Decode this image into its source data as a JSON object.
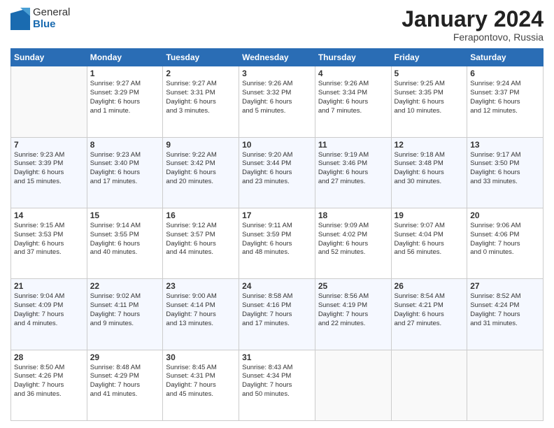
{
  "logo": {
    "general": "General",
    "blue": "Blue"
  },
  "title": "January 2024",
  "location": "Ferapontovo, Russia",
  "days_header": [
    "Sunday",
    "Monday",
    "Tuesday",
    "Wednesday",
    "Thursday",
    "Friday",
    "Saturday"
  ],
  "weeks": [
    [
      {
        "num": "",
        "detail": ""
      },
      {
        "num": "1",
        "detail": "Sunrise: 9:27 AM\nSunset: 3:29 PM\nDaylight: 6 hours\nand 1 minute."
      },
      {
        "num": "2",
        "detail": "Sunrise: 9:27 AM\nSunset: 3:31 PM\nDaylight: 6 hours\nand 3 minutes."
      },
      {
        "num": "3",
        "detail": "Sunrise: 9:26 AM\nSunset: 3:32 PM\nDaylight: 6 hours\nand 5 minutes."
      },
      {
        "num": "4",
        "detail": "Sunrise: 9:26 AM\nSunset: 3:34 PM\nDaylight: 6 hours\nand 7 minutes."
      },
      {
        "num": "5",
        "detail": "Sunrise: 9:25 AM\nSunset: 3:35 PM\nDaylight: 6 hours\nand 10 minutes."
      },
      {
        "num": "6",
        "detail": "Sunrise: 9:24 AM\nSunset: 3:37 PM\nDaylight: 6 hours\nand 12 minutes."
      }
    ],
    [
      {
        "num": "7",
        "detail": "Sunrise: 9:23 AM\nSunset: 3:39 PM\nDaylight: 6 hours\nand 15 minutes."
      },
      {
        "num": "8",
        "detail": "Sunrise: 9:23 AM\nSunset: 3:40 PM\nDaylight: 6 hours\nand 17 minutes."
      },
      {
        "num": "9",
        "detail": "Sunrise: 9:22 AM\nSunset: 3:42 PM\nDaylight: 6 hours\nand 20 minutes."
      },
      {
        "num": "10",
        "detail": "Sunrise: 9:20 AM\nSunset: 3:44 PM\nDaylight: 6 hours\nand 23 minutes."
      },
      {
        "num": "11",
        "detail": "Sunrise: 9:19 AM\nSunset: 3:46 PM\nDaylight: 6 hours\nand 27 minutes."
      },
      {
        "num": "12",
        "detail": "Sunrise: 9:18 AM\nSunset: 3:48 PM\nDaylight: 6 hours\nand 30 minutes."
      },
      {
        "num": "13",
        "detail": "Sunrise: 9:17 AM\nSunset: 3:50 PM\nDaylight: 6 hours\nand 33 minutes."
      }
    ],
    [
      {
        "num": "14",
        "detail": "Sunrise: 9:15 AM\nSunset: 3:53 PM\nDaylight: 6 hours\nand 37 minutes."
      },
      {
        "num": "15",
        "detail": "Sunrise: 9:14 AM\nSunset: 3:55 PM\nDaylight: 6 hours\nand 40 minutes."
      },
      {
        "num": "16",
        "detail": "Sunrise: 9:12 AM\nSunset: 3:57 PM\nDaylight: 6 hours\nand 44 minutes."
      },
      {
        "num": "17",
        "detail": "Sunrise: 9:11 AM\nSunset: 3:59 PM\nDaylight: 6 hours\nand 48 minutes."
      },
      {
        "num": "18",
        "detail": "Sunrise: 9:09 AM\nSunset: 4:02 PM\nDaylight: 6 hours\nand 52 minutes."
      },
      {
        "num": "19",
        "detail": "Sunrise: 9:07 AM\nSunset: 4:04 PM\nDaylight: 6 hours\nand 56 minutes."
      },
      {
        "num": "20",
        "detail": "Sunrise: 9:06 AM\nSunset: 4:06 PM\nDaylight: 7 hours\nand 0 minutes."
      }
    ],
    [
      {
        "num": "21",
        "detail": "Sunrise: 9:04 AM\nSunset: 4:09 PM\nDaylight: 7 hours\nand 4 minutes."
      },
      {
        "num": "22",
        "detail": "Sunrise: 9:02 AM\nSunset: 4:11 PM\nDaylight: 7 hours\nand 9 minutes."
      },
      {
        "num": "23",
        "detail": "Sunrise: 9:00 AM\nSunset: 4:14 PM\nDaylight: 7 hours\nand 13 minutes."
      },
      {
        "num": "24",
        "detail": "Sunrise: 8:58 AM\nSunset: 4:16 PM\nDaylight: 7 hours\nand 17 minutes."
      },
      {
        "num": "25",
        "detail": "Sunrise: 8:56 AM\nSunset: 4:19 PM\nDaylight: 7 hours\nand 22 minutes."
      },
      {
        "num": "26",
        "detail": "Sunrise: 8:54 AM\nSunset: 4:21 PM\nDaylight: 6 hours\nand 27 minutes."
      },
      {
        "num": "27",
        "detail": "Sunrise: 8:52 AM\nSunset: 4:24 PM\nDaylight: 7 hours\nand 31 minutes."
      }
    ],
    [
      {
        "num": "28",
        "detail": "Sunrise: 8:50 AM\nSunset: 4:26 PM\nDaylight: 7 hours\nand 36 minutes."
      },
      {
        "num": "29",
        "detail": "Sunrise: 8:48 AM\nSunset: 4:29 PM\nDaylight: 7 hours\nand 41 minutes."
      },
      {
        "num": "30",
        "detail": "Sunrise: 8:45 AM\nSunset: 4:31 PM\nDaylight: 7 hours\nand 45 minutes."
      },
      {
        "num": "31",
        "detail": "Sunrise: 8:43 AM\nSunset: 4:34 PM\nDaylight: 7 hours\nand 50 minutes."
      },
      {
        "num": "",
        "detail": ""
      },
      {
        "num": "",
        "detail": ""
      },
      {
        "num": "",
        "detail": ""
      }
    ]
  ]
}
